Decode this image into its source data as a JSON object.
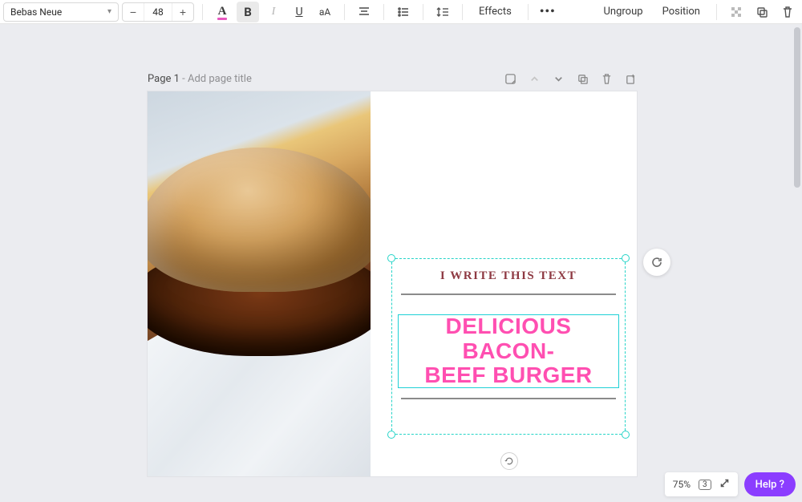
{
  "toolbar": {
    "font": "Bebas Neue",
    "fontSize": "48",
    "effects": "Effects",
    "ungroup": "Ungroup",
    "position": "Position"
  },
  "pagebar": {
    "page": "Page 1",
    "sep": " - ",
    "placeholder": "Add page title"
  },
  "canvas": {
    "text1": "I WRITE THIS TEXT",
    "text2_line1": "DELICIOUS BACON-",
    "text2_line2": "BEEF BURGER"
  },
  "footer": {
    "zoom": "75%",
    "pages": "3",
    "help": "Help ?"
  }
}
